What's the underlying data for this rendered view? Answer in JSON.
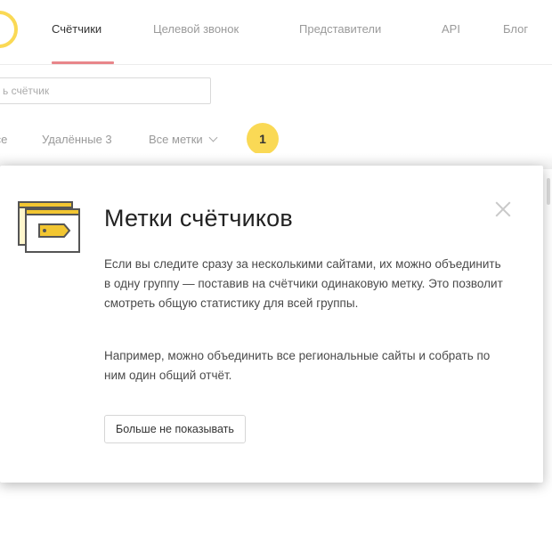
{
  "nav": {
    "tabs": [
      {
        "label": "Счётчики",
        "active": true
      },
      {
        "label": "Целевой звонок"
      },
      {
        "label": "Представители"
      },
      {
        "label": "API"
      },
      {
        "label": "Блог"
      }
    ]
  },
  "search": {
    "placeholder": "ь счётчик"
  },
  "filters": {
    "all_fragment": "Все",
    "deleted": "Удалённые 3",
    "labels_dropdown": "Все метки",
    "step_badge": "1"
  },
  "popup": {
    "title": "Метки счётчиков",
    "paragraph1": "Если вы следите сразу за несколькими сайтами, их можно объединить в одну группу — поставив на счётчики одинаковую метку. Это позволит смотреть общую статистику для всей группы.",
    "paragraph2": "Например, можно объединить все региональные сайты и собрать по ним один общий отчёт.",
    "dismiss_label": "Больше не показывать"
  },
  "colors": {
    "accent_yellow": "#fad955",
    "active_tab_underline": "#e8868a"
  }
}
